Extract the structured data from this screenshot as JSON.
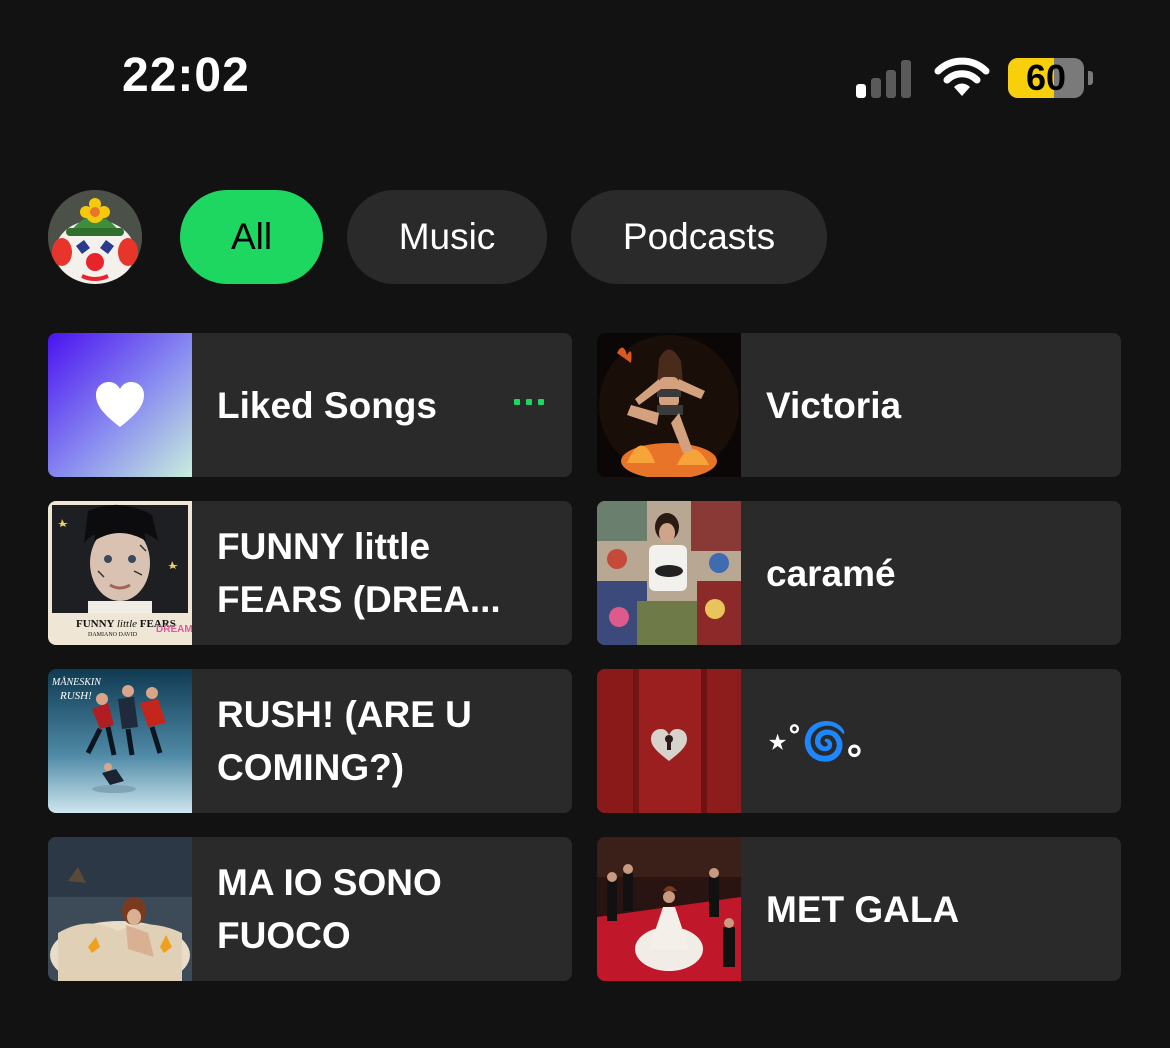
{
  "status_bar": {
    "time": "22:02",
    "battery_level": "60",
    "battery_fraction": 0.6,
    "signal_bars_active": 1,
    "signal_bars_total": 4,
    "icons": [
      "signal-icon",
      "wifi-icon",
      "battery-icon"
    ]
  },
  "filters": {
    "all_label": "All",
    "music_label": "Music",
    "podcasts_label": "Podcasts",
    "active": "All"
  },
  "grid": {
    "items": [
      {
        "title": "Liked Songs",
        "now_playing": true,
        "icon": "heart-icon"
      },
      {
        "title": "Victoria"
      },
      {
        "title": "FUNNY little FEARS (DREA..."
      },
      {
        "title": "caramé"
      },
      {
        "title": "RUSH! (ARE U COMING?)"
      },
      {
        "title": "⋆˚🌀｡"
      },
      {
        "title": "MA IO SONO FUOCO"
      },
      {
        "title": "MET GALA"
      }
    ],
    "covers": {
      "funny_little_fears_text": "FUNNY little FEARS",
      "funny_little_fears_artist": "DAMIANO DAVID",
      "funny_little_fears_dreams": "DREAMS",
      "rush_text": "MÅNESKIN RUSH!"
    }
  },
  "colors": {
    "accent": "#1ed760",
    "background": "#121212",
    "tile": "#2a2a2a",
    "battery": "#f7cf0a"
  }
}
